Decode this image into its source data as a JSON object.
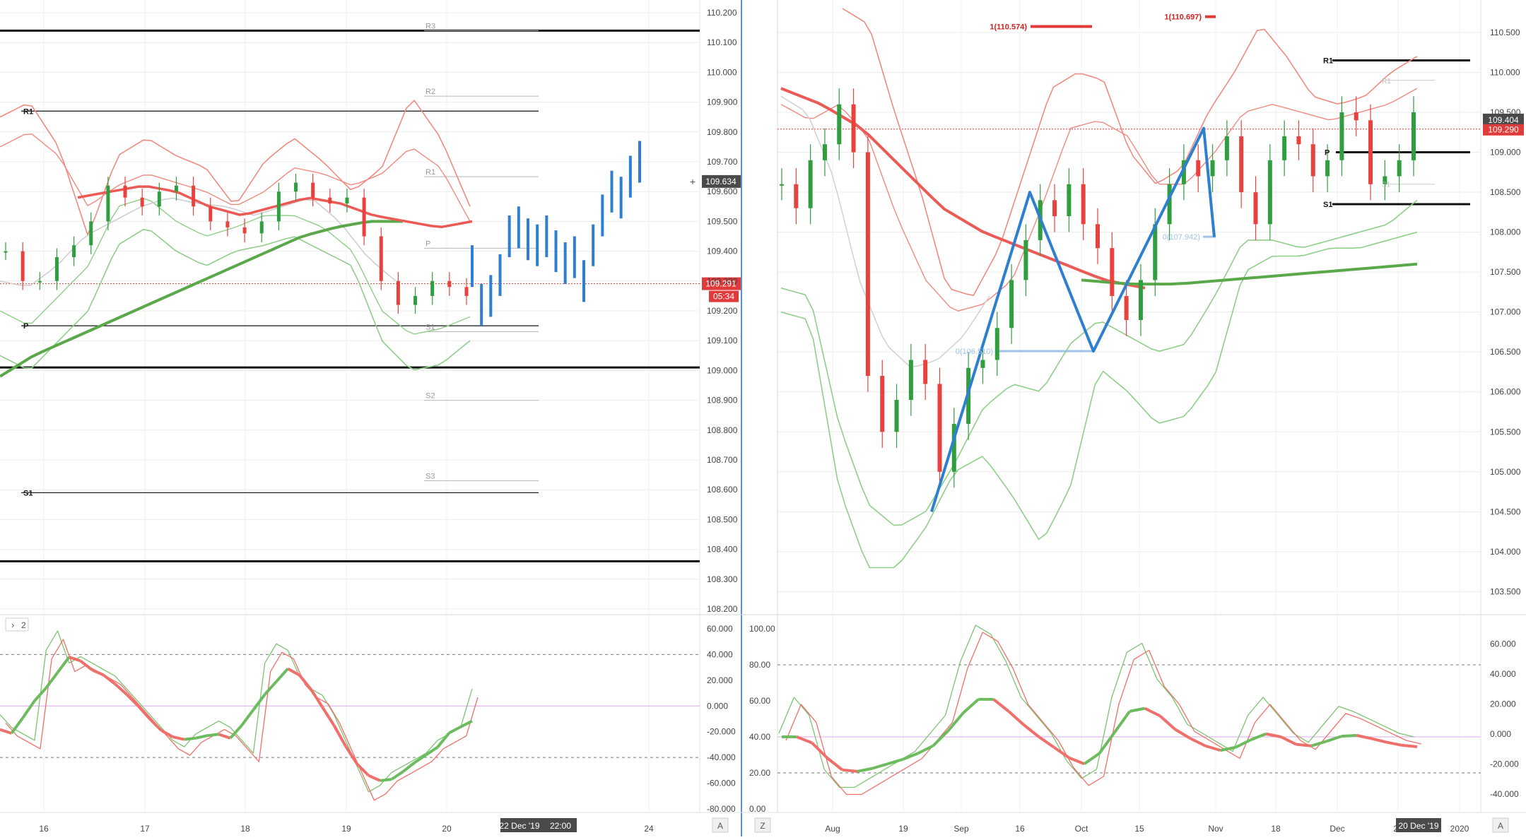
{
  "colors": {
    "bull": "#2e9e3e",
    "bear": "#e8413e",
    "projection": "#2f7fd0",
    "env_red": "#f08a80",
    "env_green": "#8ecf88",
    "ma_red": "#ec5a55",
    "ma_green": "#5aa84a",
    "price_line": "#e03a3a",
    "black": "#111111",
    "divider": "#5b8fd6",
    "grid": "#ececec"
  },
  "left": {
    "axis_labels": [
      "110.200",
      "110.100",
      "110.000",
      "109.900",
      "109.800",
      "109.700",
      "109.600",
      "109.500",
      "109.400",
      "109.300",
      "109.200",
      "109.100",
      "109.000",
      "108.900",
      "108.800",
      "108.700",
      "108.600",
      "108.500",
      "108.400",
      "108.300",
      "108.200"
    ],
    "price_marker": "109.634",
    "last_price": "109.291",
    "countdown": "05:34",
    "pivot_labels": [
      "R1",
      "P",
      "S1"
    ],
    "faded_pivot_labels": [
      "R3",
      "R2",
      "R1",
      "P",
      "S1",
      "S2",
      "S3"
    ],
    "x_labels": [
      "16",
      "17",
      "18",
      "19",
      "20",
      "24"
    ],
    "crosshair_date": "22 Dec '19",
    "crosshair_time": "22:00",
    "indicator_toggle": "2",
    "osc_labels": [
      "60.000",
      "40.000",
      "20.000",
      "0.000",
      "-20.000",
      "-40.000",
      "-60.000",
      "-80.000"
    ],
    "mode_btn": "A"
  },
  "right": {
    "axis_labels": [
      "110.500",
      "110.000",
      "109.500",
      "109.000",
      "108.500",
      "108.000",
      "107.500",
      "107.000",
      "106.500",
      "106.000",
      "105.500",
      "105.000",
      "104.500",
      "104.000",
      "103.500"
    ],
    "price_marker": "109.404",
    "last_price": "109.290",
    "pivot_labels": [
      "R1",
      "P",
      "S1"
    ],
    "faded_labels": [
      "R1",
      "S1"
    ],
    "fib_labels": [
      "1(110.574)",
      "1(110.697)"
    ],
    "fib_points": [
      "0(107.942)",
      "0(106.510)"
    ],
    "x_labels": [
      "Aug",
      "19",
      "Sep",
      "16",
      "Oct",
      "15",
      "Nov",
      "18",
      "Dec",
      "20",
      "2020"
    ],
    "crosshair_date": "20 Dec '19",
    "osc_left_labels": [
      "100.00",
      "80.00",
      "60.00",
      "40.00",
      "20.00",
      "0.00"
    ],
    "osc_right_labels": [
      "60.000",
      "40.000",
      "20.000",
      "0.000",
      "-20.000",
      "-40.000"
    ],
    "zoom_btn": "Z",
    "mode_btn": "A"
  },
  "chart_data": [
    {
      "type": "bar",
      "title": "",
      "ylim": [
        108.2,
        110.2
      ],
      "x_ticks": [
        "16",
        "17",
        "18",
        "19",
        "20",
        "24"
      ],
      "series": [
        {
          "values": [
            109.4,
            109.3,
            109.3,
            109.38,
            109.42,
            109.5,
            109.62,
            109.58,
            109.55,
            109.6,
            109.62,
            109.55,
            109.5,
            109.48,
            109.46,
            109.5,
            109.6,
            109.63,
            109.58,
            109.56,
            109.58,
            109.45,
            109.3,
            109.22,
            109.25,
            109.3,
            109.28,
            109.25
          ]
        },
        {
          "name": "projection",
          "values": [
            109.35,
            109.22,
            109.25,
            109.32,
            109.45,
            109.48,
            109.44,
            109.42,
            109.45,
            109.4,
            109.36,
            109.38,
            109.3,
            109.42,
            109.52,
            109.6,
            109.58,
            109.65,
            109.7
          ]
        }
      ],
      "levels": {
        "R1": 109.87,
        "P": 109.15,
        "S1": 108.59,
        "heavy": [
          110.14,
          109.01,
          108.36
        ],
        "last": 109.291
      }
    },
    {
      "type": "bar",
      "title": "",
      "ylim": [
        103.3,
        110.8
      ],
      "x_ticks": [
        "Aug",
        "19",
        "Sep",
        "16",
        "Oct",
        "15",
        "Nov",
        "18",
        "Dec",
        "20",
        "2020"
      ],
      "series": [
        {
          "values": [
            108.6,
            108.3,
            108.9,
            109.1,
            109.6,
            109.0,
            106.2,
            105.5,
            105.9,
            106.4,
            106.1,
            105.0,
            105.6,
            106.3,
            106.4,
            106.8,
            107.4,
            107.9,
            108.4,
            108.2,
            108.6,
            108.1,
            107.8,
            107.2,
            106.9,
            107.4,
            108.1,
            108.6,
            108.9,
            108.7,
            108.9,
            109.2,
            108.5,
            108.1,
            108.9,
            109.2,
            109.1,
            108.7,
            108.9,
            109.5,
            109.4,
            108.6,
            108.7,
            108.9,
            109.5
          ]
        }
      ],
      "levels": {
        "R1": 110.15,
        "P": 109.0,
        "S1": 108.35,
        "last": 109.29
      },
      "fib": [
        {
          "label": "1(110.574)",
          "value": 110.574
        },
        {
          "label": "1(110.697)",
          "value": 110.697
        },
        {
          "label": "0(107.942)",
          "value": 107.942
        },
        {
          "label": "0(106.510)",
          "value": 106.51
        }
      ]
    },
    {
      "type": "line",
      "title": "",
      "ylim": [
        -80,
        60
      ],
      "series": [
        {
          "name": "",
          "values": [
            -10,
            -20,
            -25,
            -30,
            40,
            55,
            30,
            35,
            30,
            25,
            20,
            10,
            0,
            -10,
            -20,
            -30,
            -35,
            -25,
            -20,
            -15,
            -20,
            -30,
            -40,
            30,
            45,
            40,
            20,
            10,
            5,
            -10,
            -30,
            -50,
            -70,
            -65,
            -55,
            -50,
            -45,
            -40,
            -30,
            -25,
            -20,
            10
          ]
        }
      ]
    },
    {
      "type": "line",
      "title": "",
      "ylim": [
        0,
        100
      ],
      "series": [
        {
          "name": "",
          "values": [
            40,
            60,
            50,
            20,
            10,
            10,
            15,
            20,
            25,
            30,
            40,
            50,
            80,
            100,
            95,
            80,
            60,
            50,
            40,
            25,
            15,
            20,
            60,
            85,
            90,
            70,
            60,
            45,
            40,
            35,
            30,
            50,
            60,
            50,
            40,
            35,
            45,
            55,
            52,
            48,
            44,
            40,
            38
          ]
        }
      ]
    }
  ]
}
